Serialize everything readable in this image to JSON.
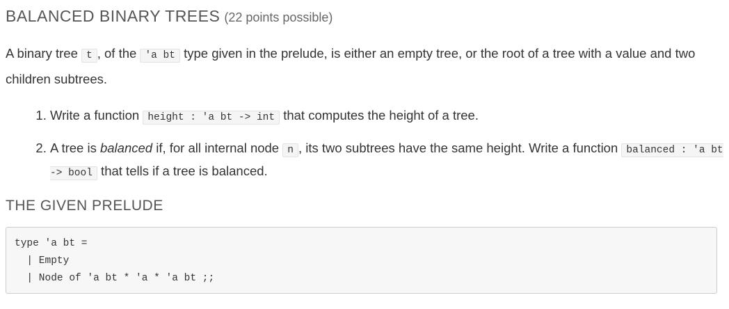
{
  "title": "BALANCED BINARY TREES",
  "points": "(22 points possible)",
  "intro": {
    "t1": "A binary tree ",
    "c1": "t",
    "t2": ", of the ",
    "c2": "'a bt",
    "t3": " type given in the prelude, is either an empty tree, or the root of a tree with a value and two children subtrees."
  },
  "items": [
    {
      "t1": "Write a function ",
      "c1": "height : 'a bt -> int",
      "t2": " that computes the height of a tree."
    },
    {
      "t1": "A tree is ",
      "em": "balanced",
      "t2": " if, for all internal node ",
      "c1": "n",
      "t3": ", its two subtrees have the same height. Write a function ",
      "c2": "balanced : 'a bt -> bool",
      "t4": " that tells if a tree is balanced."
    }
  ],
  "prelude_heading": "THE GIVEN PRELUDE",
  "prelude_lines": [
    "type 'a bt =",
    "  | Empty",
    "  | Node of 'a bt * 'a * 'a bt ;;"
  ]
}
